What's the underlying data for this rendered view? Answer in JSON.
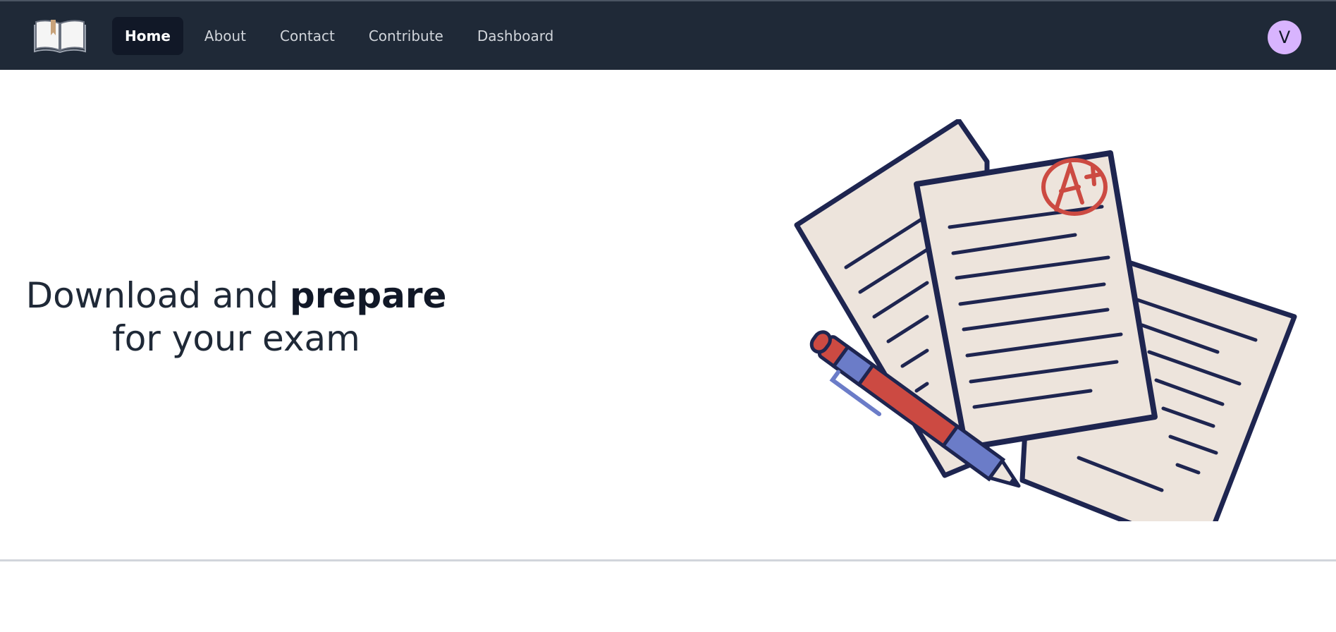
{
  "nav": {
    "logo_icon": "open-book-icon",
    "links": [
      {
        "label": "Home",
        "active": true
      },
      {
        "label": "About",
        "active": false
      },
      {
        "label": "Contact",
        "active": false
      },
      {
        "label": "Contribute",
        "active": false
      },
      {
        "label": "Dashboard",
        "active": false
      }
    ],
    "avatar_initial": "V"
  },
  "hero": {
    "title_part1": "Download and ",
    "title_part2": "prepare",
    "title_part3": " for your exam",
    "illustration_icon": "exam-papers-with-pen-illustration",
    "grade_mark": "A+"
  },
  "colors": {
    "nav_bg": "#1f2937",
    "active_link_bg": "#111827",
    "avatar_bg": "#d8b4fe",
    "paper": "#ede4dc",
    "ink": "#1e2550",
    "red": "#cc4a42",
    "blue": "#6b7cc8"
  }
}
